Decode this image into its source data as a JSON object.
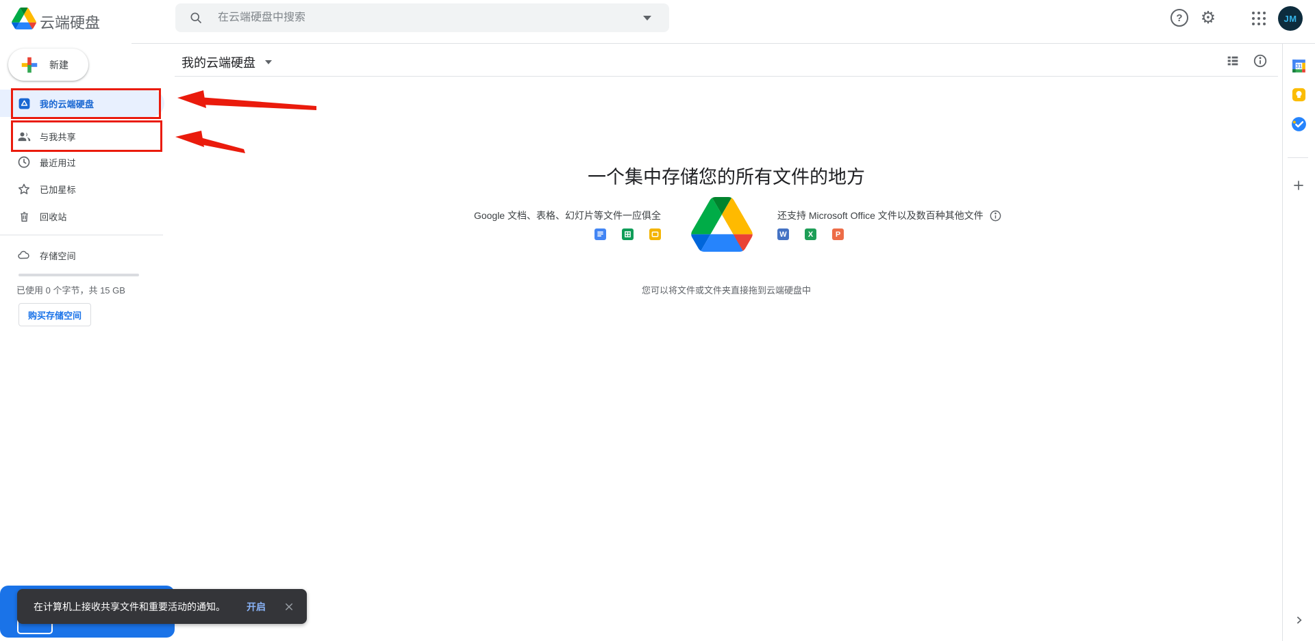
{
  "header": {
    "app_title": "云端硬盘",
    "search_placeholder": "在云端硬盘中搜索",
    "help_glyph": "?",
    "avatar_text": "JM"
  },
  "sidebar": {
    "new_button_label": "新建",
    "items": [
      {
        "label": "我的云端硬盘",
        "active": true
      },
      {
        "label": "与我共享",
        "active": false
      },
      {
        "label": "最近用过",
        "active": false
      },
      {
        "label": "已加星标",
        "active": false
      },
      {
        "label": "回收站",
        "active": false
      }
    ],
    "storage": {
      "label": "存储空间",
      "usage_text": "已使用 0 个字节，共 15 GB",
      "used_fraction": 0,
      "buy_button_label": "购买存储空间"
    }
  },
  "content": {
    "breadcrumb": "我的云端硬盘",
    "empty_state": {
      "heading": "一个集中存储您的所有文件的地方",
      "left_caption": "Google 文档、表格、幻灯片等文件一应俱全",
      "right_caption": "还支持 Microsoft Office 文件以及数百种其他文件",
      "office_letters": [
        "W",
        "X",
        "P"
      ],
      "drag_hint": "您可以将文件或文件夹直接拖到云端硬盘中"
    }
  },
  "right_rail": {
    "calendar_label": "31"
  },
  "toast": {
    "message": "在计算机上接收共享文件和重要活动的通知。",
    "action_label": "开启"
  },
  "colors": {
    "accent": "#1a73e8",
    "active_item_bg": "#e8f0fe",
    "active_item_text": "#1967d2",
    "toast_bg": "#343539",
    "toast_action": "#8ab4f8",
    "annotation_red": "#ea1b0c"
  }
}
